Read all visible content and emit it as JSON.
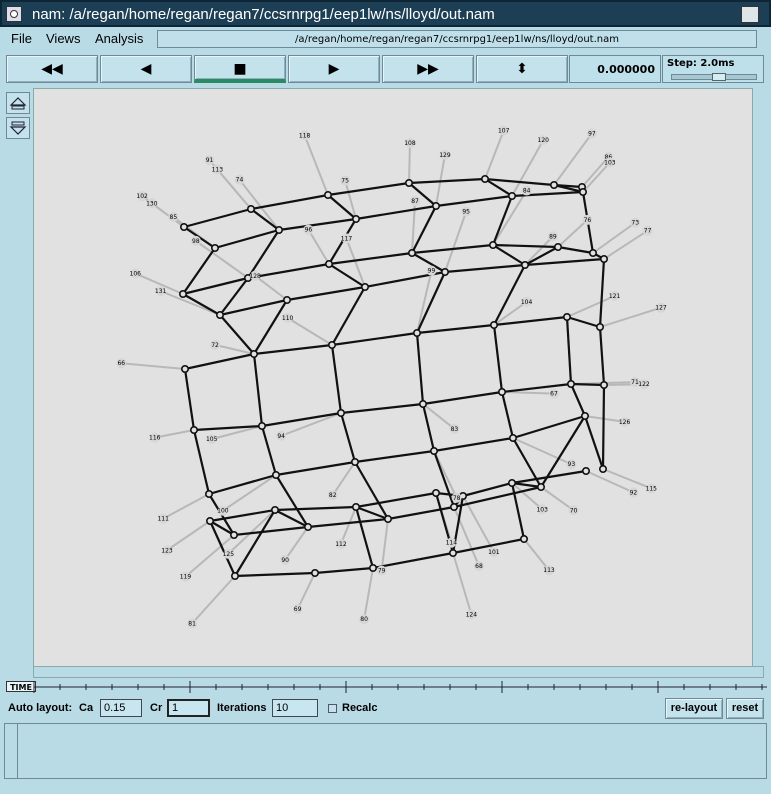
{
  "window": {
    "title": "nam: /a/regan/home/regan/regan7/ccsrnrpg1/eep1lw/ns/lloyd/out.nam"
  },
  "menu": {
    "file": "File",
    "views": "Views",
    "analysis": "Analysis"
  },
  "path": "/a/regan/home/regan/regan7/ccsrnrpg1/eep1lw/ns/lloyd/out.nam",
  "playback": {
    "rewind": "◀◀",
    "back": "◀",
    "stop": "■",
    "play": "▶",
    "fastforward": "▶▶",
    "eject": "⬍",
    "time": "0.000000",
    "step_label": "Step: 2.0ms",
    "active": "stop"
  },
  "timeline_label": "TIME",
  "autolayout": {
    "label": "Auto layout:",
    "ca_label": "Ca",
    "ca_value": "0.15",
    "cr_label": "Cr",
    "cr_value": "1",
    "iter_label": "Iterations",
    "iter_value": "10",
    "recalc_label": "Recalc",
    "relayout": "re-layout",
    "reset": "reset"
  },
  "network": {
    "labels": [
      "130",
      "113",
      "118",
      "108",
      "107",
      "97",
      "86",
      "85",
      "74",
      "75",
      "129",
      "120",
      "103",
      "106",
      "98",
      "96",
      "87",
      "84",
      "76",
      "73",
      "131",
      "128",
      "117",
      "95",
      "89",
      "77",
      "66",
      "72",
      "110",
      "99",
      "104",
      "121",
      "127",
      "116",
      "105",
      "94",
      "83",
      "67",
      "71",
      "122",
      "111",
      "100",
      "82",
      "78",
      "93",
      "126",
      "115",
      "119",
      "90",
      "79",
      "68",
      "70",
      "123",
      "125",
      "112",
      "114",
      "101",
      "103",
      "92",
      "81",
      "69",
      "80",
      "124",
      "113",
      "102",
      "91"
    ]
  }
}
